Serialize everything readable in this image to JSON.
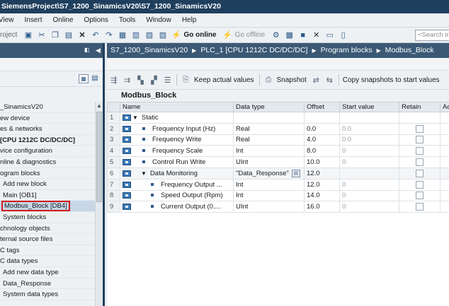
{
  "window": {
    "title": "SiemensProject\\S7_1200_SinamicsV20\\S7_1200_SinamicsV20"
  },
  "menu": {
    "items": [
      "View",
      "Insert",
      "Online",
      "Options",
      "Tools",
      "Window",
      "Help"
    ]
  },
  "toolbar": {
    "project_label": "roject",
    "go_online": "Go online",
    "go_offline": "Go offline",
    "search_placeholder": "<Search in"
  },
  "left_panel": {
    "tree": [
      {
        "label": "_SinamicsV20",
        "indent": 1
      },
      {
        "label": "ew device",
        "indent": 1
      },
      {
        "label": "es & networks",
        "indent": 1
      },
      {
        "label": " [CPU 1212C DC/DC/DC]",
        "indent": 1,
        "bold": true
      },
      {
        "label": "vice configuration",
        "indent": 1
      },
      {
        "label": "nline & diagnostics",
        "indent": 1
      },
      {
        "label": "ogram blocks",
        "indent": 1
      },
      {
        "label": "Add new block",
        "indent": 2
      },
      {
        "label": "Main [OB1]",
        "indent": 2
      },
      {
        "label": "Modbus_Block [DB4]",
        "indent": 2,
        "highlight": true
      },
      {
        "label": "System blocks",
        "indent": 2
      },
      {
        "label": "chnology objects",
        "indent": 1
      },
      {
        "label": "ternal source files",
        "indent": 1
      },
      {
        "label": "C tags",
        "indent": 1
      },
      {
        "label": "C data types",
        "indent": 1
      },
      {
        "label": "Add new data type",
        "indent": 2
      },
      {
        "label": "Data_Response",
        "indent": 2
      },
      {
        "label": "System data types",
        "indent": 2
      }
    ]
  },
  "breadcrumb": {
    "items": [
      "S7_1200_SinamicsV20",
      "PLC_1 [CPU 1212C DC/DC/DC]",
      "Program blocks",
      "Modbus_Block"
    ]
  },
  "editor_toolbar": {
    "keep_actual": "Keep actual values",
    "snapshot": "Snapshot",
    "copy_snapshots": "Copy snapshots to start values"
  },
  "block": {
    "title": "Modbus_Block"
  },
  "table": {
    "headers": [
      "",
      "Name",
      "Data type",
      "Offset",
      "Start value",
      "Retain",
      "Ac"
    ],
    "rows": [
      {
        "num": "1",
        "name": "Static",
        "level": 0,
        "expanded": true,
        "data_type": "",
        "offset": "",
        "start": "",
        "retain": false
      },
      {
        "num": "2",
        "name": "Frequency Input (Hz)",
        "level": 1,
        "data_type": "Real",
        "offset": "0.0",
        "start": "0.0",
        "retain": true
      },
      {
        "num": "3",
        "name": "Frequency Write",
        "level": 1,
        "data_type": "Real",
        "offset": "4.0",
        "start": "0.0",
        "retain": true
      },
      {
        "num": "4",
        "name": "Frequency Scale",
        "level": 1,
        "data_type": "Int",
        "offset": "8.0",
        "start": "0",
        "retain": true
      },
      {
        "num": "5",
        "name": "Control Run Write",
        "level": 1,
        "data_type": "UInt",
        "offset": "10.0",
        "start": "0",
        "retain": true
      },
      {
        "num": "6",
        "name": "Data Monitoring",
        "level": 1,
        "expanded": true,
        "data_type": "\"Data_Response\"",
        "offset": "12.0",
        "start": "",
        "retain": true,
        "selected": true
      },
      {
        "num": "7",
        "name": "Frequency Output ...",
        "level": 2,
        "data_type": "Int",
        "offset": "12.0",
        "start": "0",
        "retain": true
      },
      {
        "num": "8",
        "name": "Speed Output (Rpm)",
        "level": 2,
        "data_type": "Int",
        "offset": "14.0",
        "start": "0",
        "retain": true
      },
      {
        "num": "9",
        "name": "Current Output (0....",
        "level": 2,
        "data_type": "UInt",
        "offset": "16.0",
        "start": "0",
        "retain": true
      }
    ]
  }
}
